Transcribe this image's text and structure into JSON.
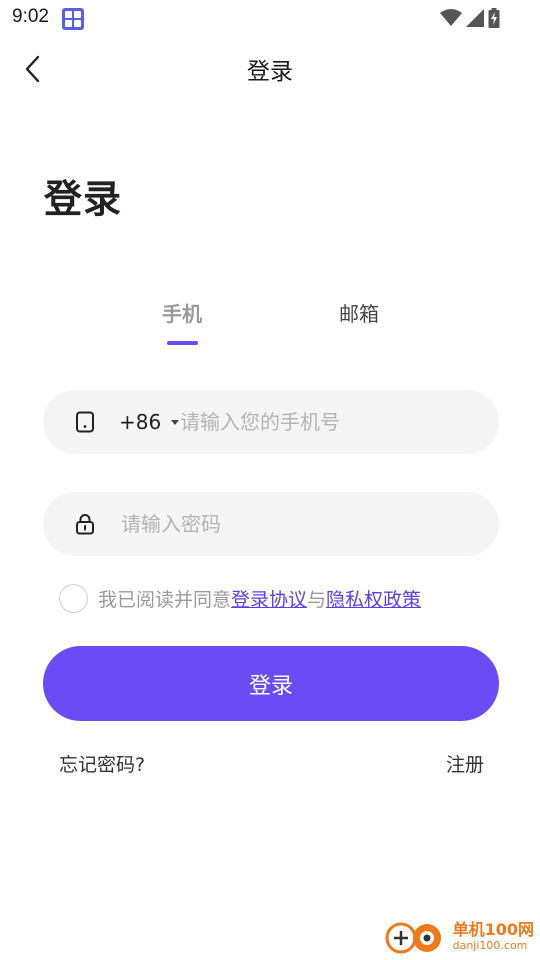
{
  "status_bar": {
    "time": "9:02",
    "icons": [
      "app-grid-icon",
      "wifi-icon",
      "cellular-signal-icon",
      "battery-charging-icon"
    ]
  },
  "header": {
    "back_icon": "chevron-left-icon",
    "title": "登录"
  },
  "page_heading": "登录",
  "tabs": [
    {
      "label": "手机",
      "active": true
    },
    {
      "label": "邮箱",
      "active": false
    }
  ],
  "phone_field": {
    "icon": "phone-icon",
    "country_code": "+86",
    "value": "",
    "placeholder": "请输入您的手机号"
  },
  "password_field": {
    "icon": "lock-icon",
    "value": "",
    "placeholder": "请输入密码"
  },
  "agreement": {
    "checked": false,
    "prefix": "我已阅读并同意",
    "terms_link": "登录协议",
    "conjunction": "与",
    "privacy_link": "隐私权政策"
  },
  "login_button": "登录",
  "forgot_password": "忘记密码?",
  "register": "注册",
  "watermark": {
    "name": "单机100网",
    "domain": "danji100.com"
  },
  "colors": {
    "accent": "#6a4cf5",
    "link": "#5a3ff0",
    "field_bg": "#f5f5f5",
    "muted_text": "#9a9a9a",
    "watermark": "#f07a1a"
  }
}
